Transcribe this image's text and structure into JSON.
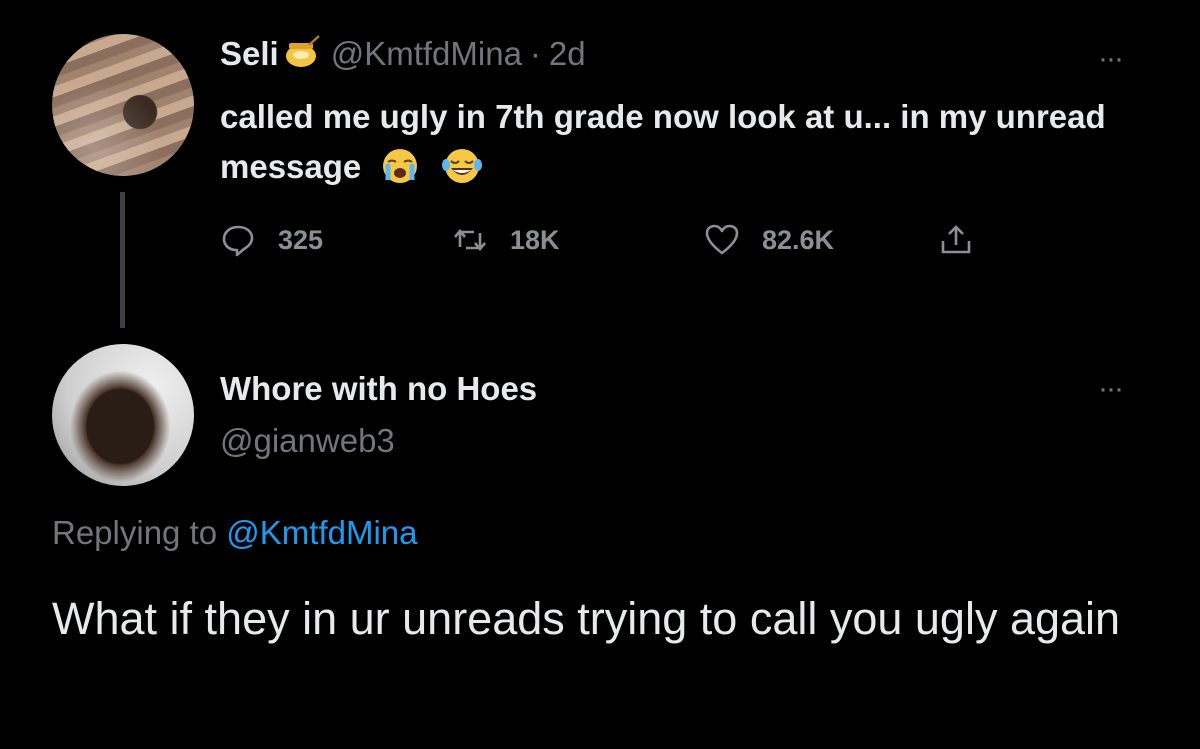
{
  "tweet1": {
    "author_name": "Seli",
    "author_handle": "@KmtfdMina",
    "separator": "·",
    "time": "2d",
    "name_emoji": "honey-pot-icon",
    "text": "called me ugly in 7th grade now look at u... in my unread message",
    "text_emojis": [
      "loudly-crying-face-icon",
      "face-with-tears-of-joy-icon"
    ],
    "more_label": "···",
    "stats": {
      "replies": "325",
      "retweets": "18K",
      "likes": "82.6K"
    }
  },
  "tweet2": {
    "author_name": "Whore with no Hoes",
    "author_handle": "@gianweb3",
    "more_label": "···",
    "replying_prefix": "Replying to",
    "replying_handle": "@KmtfdMina",
    "text": "What if they in ur unreads trying to call you ugly again"
  },
  "colors": {
    "background": "#000000",
    "primary_text": "#e7e9ea",
    "secondary_text": "#71767b",
    "link": "#1d9bf0"
  }
}
